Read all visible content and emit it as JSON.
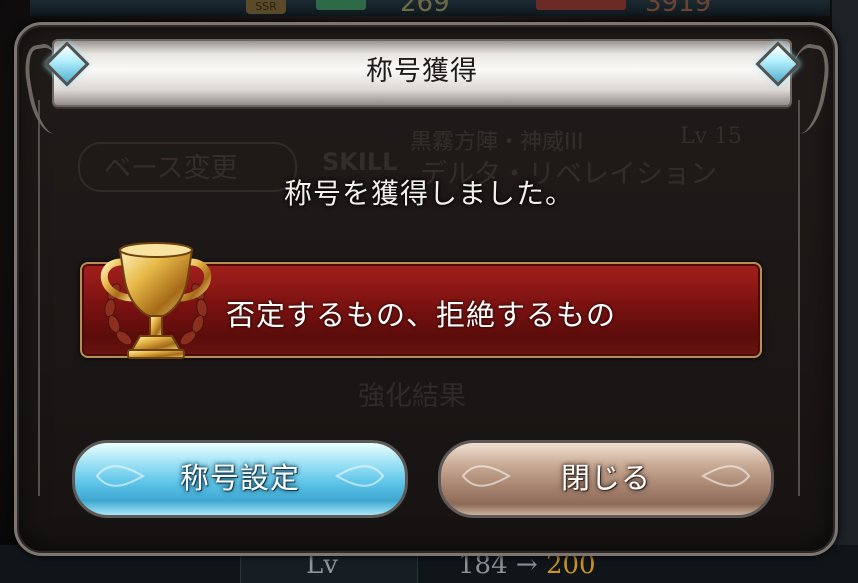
{
  "background": {
    "ssr_badge": "SSR",
    "hp_value": "269",
    "atk_value": "3919",
    "base_change_button": "ベース変更",
    "skill_label": "SKILL",
    "skill_subtitle": "黒霧方陣・神威III",
    "skill_level": "Lv 15",
    "skill_name": "デルタ・リベレイション",
    "enhance_result": "強化結果",
    "lv_label": "Lv",
    "lv_from": "184",
    "lv_arrow": "→",
    "lv_to": "200"
  },
  "dialog": {
    "header_title": "称号獲得",
    "message": "称号を獲得しました。",
    "title_name": "否定するもの、拒絶するもの",
    "trophy_icon": "gold-trophy-icon",
    "buttons": {
      "set_title": "称号設定",
      "close": "閉じる"
    }
  },
  "colors": {
    "title_bar": "#7a1210",
    "button_blue": "#5fc5e8",
    "button_brown": "#a88571",
    "level_to": "#c9932a"
  }
}
